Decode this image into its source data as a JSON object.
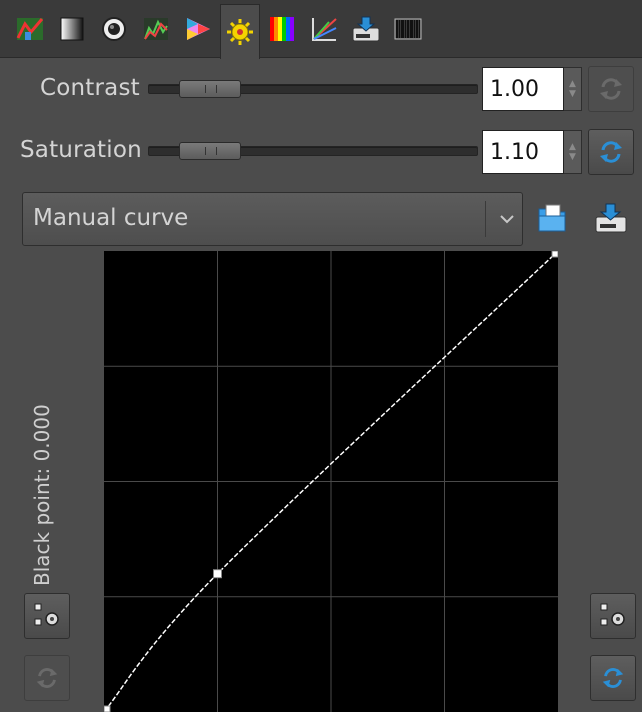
{
  "toolbar": {
    "tabs": [
      {
        "icon": "tone-curve-icon"
      },
      {
        "icon": "gradient-icon"
      },
      {
        "icon": "lens-icon"
      },
      {
        "icon": "histogram-icon"
      },
      {
        "icon": "color-triangle-icon"
      },
      {
        "icon": "sun-gear-icon"
      },
      {
        "icon": "rainbow-icon"
      },
      {
        "icon": "rgb-curves-icon"
      },
      {
        "icon": "save-to-disk-icon"
      },
      {
        "icon": "barcode-icon"
      }
    ]
  },
  "contrast": {
    "label": "Contrast",
    "value": "1.00",
    "level": 0.1
  },
  "saturation": {
    "label": "Saturation",
    "value": "1.10",
    "level": 0.1
  },
  "curve_mode": {
    "selected": "Manual curve"
  },
  "curve": {
    "black_point_label": "Black point: 0.000",
    "points": [
      [
        0,
        0
      ],
      [
        0.25,
        0.3
      ],
      [
        1,
        1
      ]
    ]
  },
  "colors": {
    "accent": "#2a8fd6",
    "curve": "#ffffff",
    "grid": "#4a4a4a"
  }
}
